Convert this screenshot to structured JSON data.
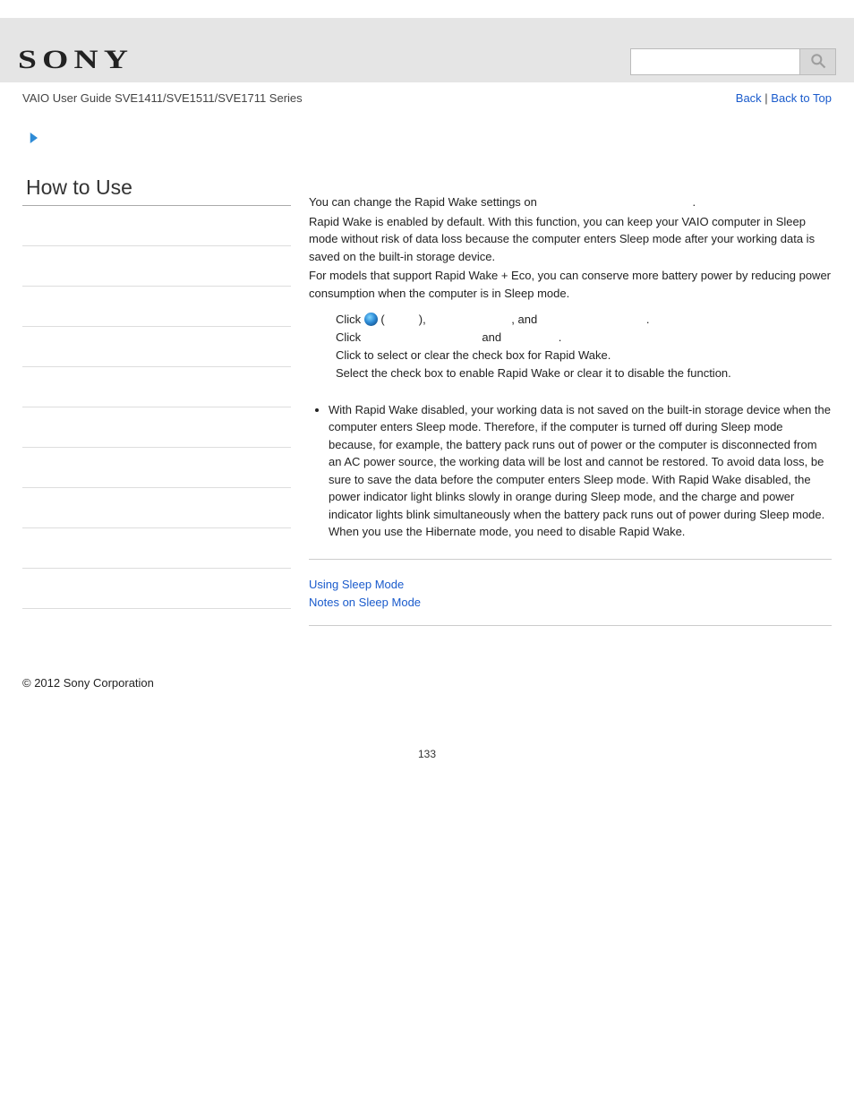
{
  "header": {
    "logo_text": "SONY",
    "search_placeholder": ""
  },
  "subheader": {
    "guide_title": "VAIO User Guide SVE1411/SVE1511/SVE1711 Series",
    "back_label": "Back",
    "back_to_top_label": "Back to Top",
    "separator": " | "
  },
  "sidebar": {
    "title": "How to Use",
    "item_count": 10
  },
  "main": {
    "intro_line_1a": "You can change the Rapid Wake settings on ",
    "intro_line_1b": ".",
    "intro_para": "Rapid Wake is enabled by default. With this function, you can keep your VAIO computer in Sleep mode without risk of data loss because the computer enters Sleep mode after your working data is saved on the built-in storage device.",
    "intro_para2": "For models that support Rapid Wake + Eco, you can conserve more battery power by reducing power consumption when the computer is in Sleep mode.",
    "steps": {
      "s1_a": "Click ",
      "s1_b": " (",
      "s1_c": "), ",
      "s1_d": ", and ",
      "s1_e": ".",
      "s2_a": "Click ",
      "s2_b": " and ",
      "s2_c": ".",
      "s3": "Click to select or clear the check box for Rapid Wake.",
      "s4": "Select the check box to enable Rapid Wake or clear it to disable the function."
    },
    "note_bullet_1": "With Rapid Wake disabled, your working data is not saved on the built-in storage device when the computer enters Sleep mode. Therefore, if the computer is turned off during Sleep mode because, for example, the battery pack runs out of power or the computer is disconnected from an AC power source, the working data will be lost and cannot be restored. To avoid data loss, be sure to save the data before the computer enters Sleep mode. With Rapid Wake disabled, the power indicator light blinks slowly in orange during Sleep mode, and the charge and power indicator lights blink simultaneously when the battery pack runs out of power during Sleep mode.",
    "note_bullet_1b": "When you use the Hibernate mode, you need to disable Rapid Wake.",
    "related": {
      "link1": "Using Sleep Mode",
      "link2": "Notes on Sleep Mode"
    }
  },
  "footer": {
    "copyright": "© 2012 Sony Corporation",
    "page_number": "133"
  }
}
